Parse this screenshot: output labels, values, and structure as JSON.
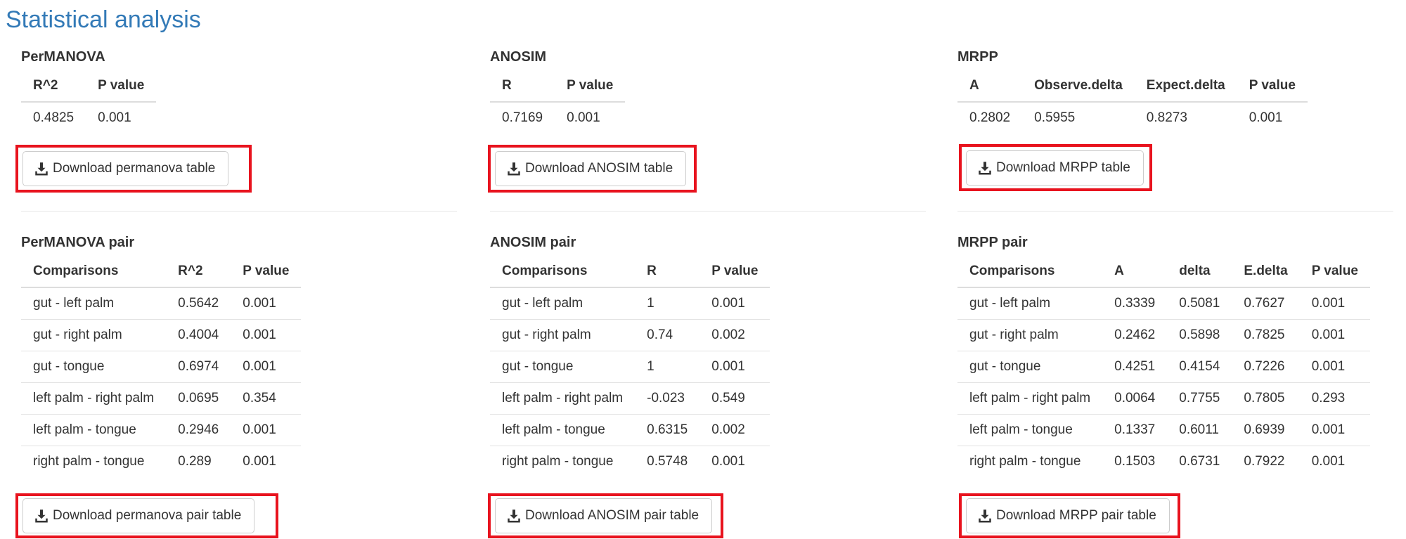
{
  "page": {
    "title": "Statistical analysis"
  },
  "permanova": {
    "title": "PerMANOVA",
    "headers": [
      "R^2",
      "P value"
    ],
    "rows": [
      [
        "0.4825",
        "0.001"
      ]
    ],
    "download_label": "Download permanova table"
  },
  "anosim": {
    "title": "ANOSIM",
    "headers": [
      "R",
      "P value"
    ],
    "rows": [
      [
        "0.7169",
        "0.001"
      ]
    ],
    "download_label": "Download ANOSIM table"
  },
  "mrpp": {
    "title": "MRPP",
    "headers": [
      "A",
      "Observe.delta",
      "Expect.delta",
      "P value"
    ],
    "rows": [
      [
        "0.2802",
        "0.5955",
        "0.8273",
        "0.001"
      ]
    ],
    "download_label": "Download MRPP table"
  },
  "permanova_pair": {
    "title": "PerMANOVA pair",
    "headers": [
      "Comparisons",
      "R^2",
      "P value"
    ],
    "rows": [
      [
        "gut - left palm",
        "0.5642",
        "0.001"
      ],
      [
        "gut - right palm",
        "0.4004",
        "0.001"
      ],
      [
        "gut - tongue",
        "0.6974",
        "0.001"
      ],
      [
        "left palm - right palm",
        "0.0695",
        "0.354"
      ],
      [
        "left palm - tongue",
        "0.2946",
        "0.001"
      ],
      [
        "right palm - tongue",
        "0.289",
        "0.001"
      ]
    ],
    "download_label": "Download permanova pair table"
  },
  "anosim_pair": {
    "title": "ANOSIM pair",
    "headers": [
      "Comparisons",
      "R",
      "P value"
    ],
    "rows": [
      [
        "gut - left palm",
        "1",
        "0.001"
      ],
      [
        "gut - right palm",
        "0.74",
        "0.002"
      ],
      [
        "gut - tongue",
        "1",
        "0.001"
      ],
      [
        "left palm - right palm",
        "-0.023",
        "0.549"
      ],
      [
        "left palm - tongue",
        "0.6315",
        "0.002"
      ],
      [
        "right palm - tongue",
        "0.5748",
        "0.001"
      ]
    ],
    "download_label": "Download ANOSIM pair table"
  },
  "mrpp_pair": {
    "title": "MRPP pair",
    "headers": [
      "Comparisons",
      "A",
      "delta",
      "E.delta",
      "P value"
    ],
    "rows": [
      [
        "gut - left palm",
        "0.3339",
        "0.5081",
        "0.7627",
        "0.001"
      ],
      [
        "gut - right palm",
        "0.2462",
        "0.5898",
        "0.7825",
        "0.001"
      ],
      [
        "gut - tongue",
        "0.4251",
        "0.4154",
        "0.7226",
        "0.001"
      ],
      [
        "left palm - right palm",
        "0.0064",
        "0.7755",
        "0.7805",
        "0.293"
      ],
      [
        "left palm - tongue",
        "0.1337",
        "0.6011",
        "0.6939",
        "0.001"
      ],
      [
        "right palm - tongue",
        "0.1503",
        "0.6731",
        "0.7922",
        "0.001"
      ]
    ],
    "download_label": "Download MRPP pair table"
  },
  "icons": {
    "download": "download-icon"
  },
  "colors": {
    "title": "#337ab7",
    "highlight_frame": "#e8131e",
    "text": "#333333"
  }
}
